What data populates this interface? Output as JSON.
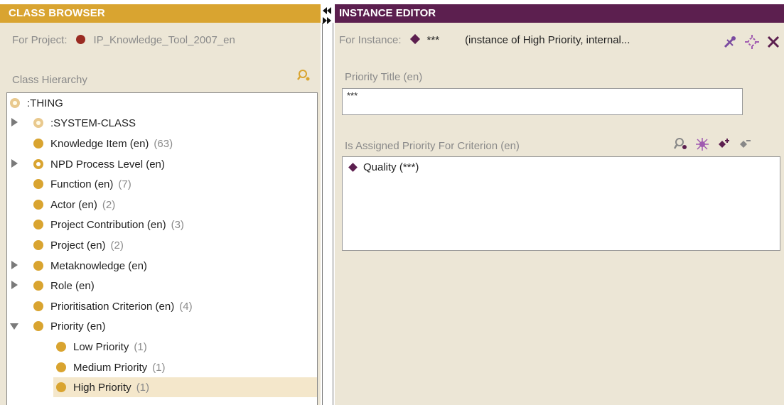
{
  "class_browser": {
    "title": "CLASS BROWSER",
    "project_label": "For Project:",
    "project_name": "IP_Knowledge_Tool_2007_en",
    "hierarchy_label": "Class Hierarchy",
    "tree": [
      {
        "label": ":THING",
        "count": ""
      },
      {
        "label": ":SYSTEM-CLASS",
        "count": ""
      },
      {
        "label": "Knowledge Item (en)",
        "count": "(63)"
      },
      {
        "label": "NPD Process Level (en)",
        "count": ""
      },
      {
        "label": "Function (en)",
        "count": "(7)"
      },
      {
        "label": "Actor (en)",
        "count": "(2)"
      },
      {
        "label": "Project Contribution (en)",
        "count": "(3)"
      },
      {
        "label": "Project (en)",
        "count": "(2)"
      },
      {
        "label": "Metaknowledge (en)",
        "count": ""
      },
      {
        "label": "Role (en)",
        "count": ""
      },
      {
        "label": "Prioritisation Criterion (en)",
        "count": "(4)"
      },
      {
        "label": "Priority (en)",
        "count": ""
      },
      {
        "label": "Low Priority",
        "count": "(1)"
      },
      {
        "label": "Medium Priority",
        "count": "(1)"
      },
      {
        "label": "High Priority",
        "count": "(1)"
      }
    ]
  },
  "instance_editor": {
    "title": "INSTANCE EDITOR",
    "instance_label": "For Instance:",
    "instance_value": "***",
    "instance_desc": "(instance of High Priority, internal...",
    "priority_title_label": "Priority Title (en)",
    "priority_title_value": "***",
    "assigned_label": "Is Assigned Priority For Criterion (en)",
    "assigned_items": [
      {
        "label": "Quality (***)"
      }
    ]
  },
  "colors": {
    "class_header": "#d9a430",
    "instance_header": "#5c1f4f",
    "panel_bg": "#ece6d6",
    "selection": "#f4e7cb"
  }
}
